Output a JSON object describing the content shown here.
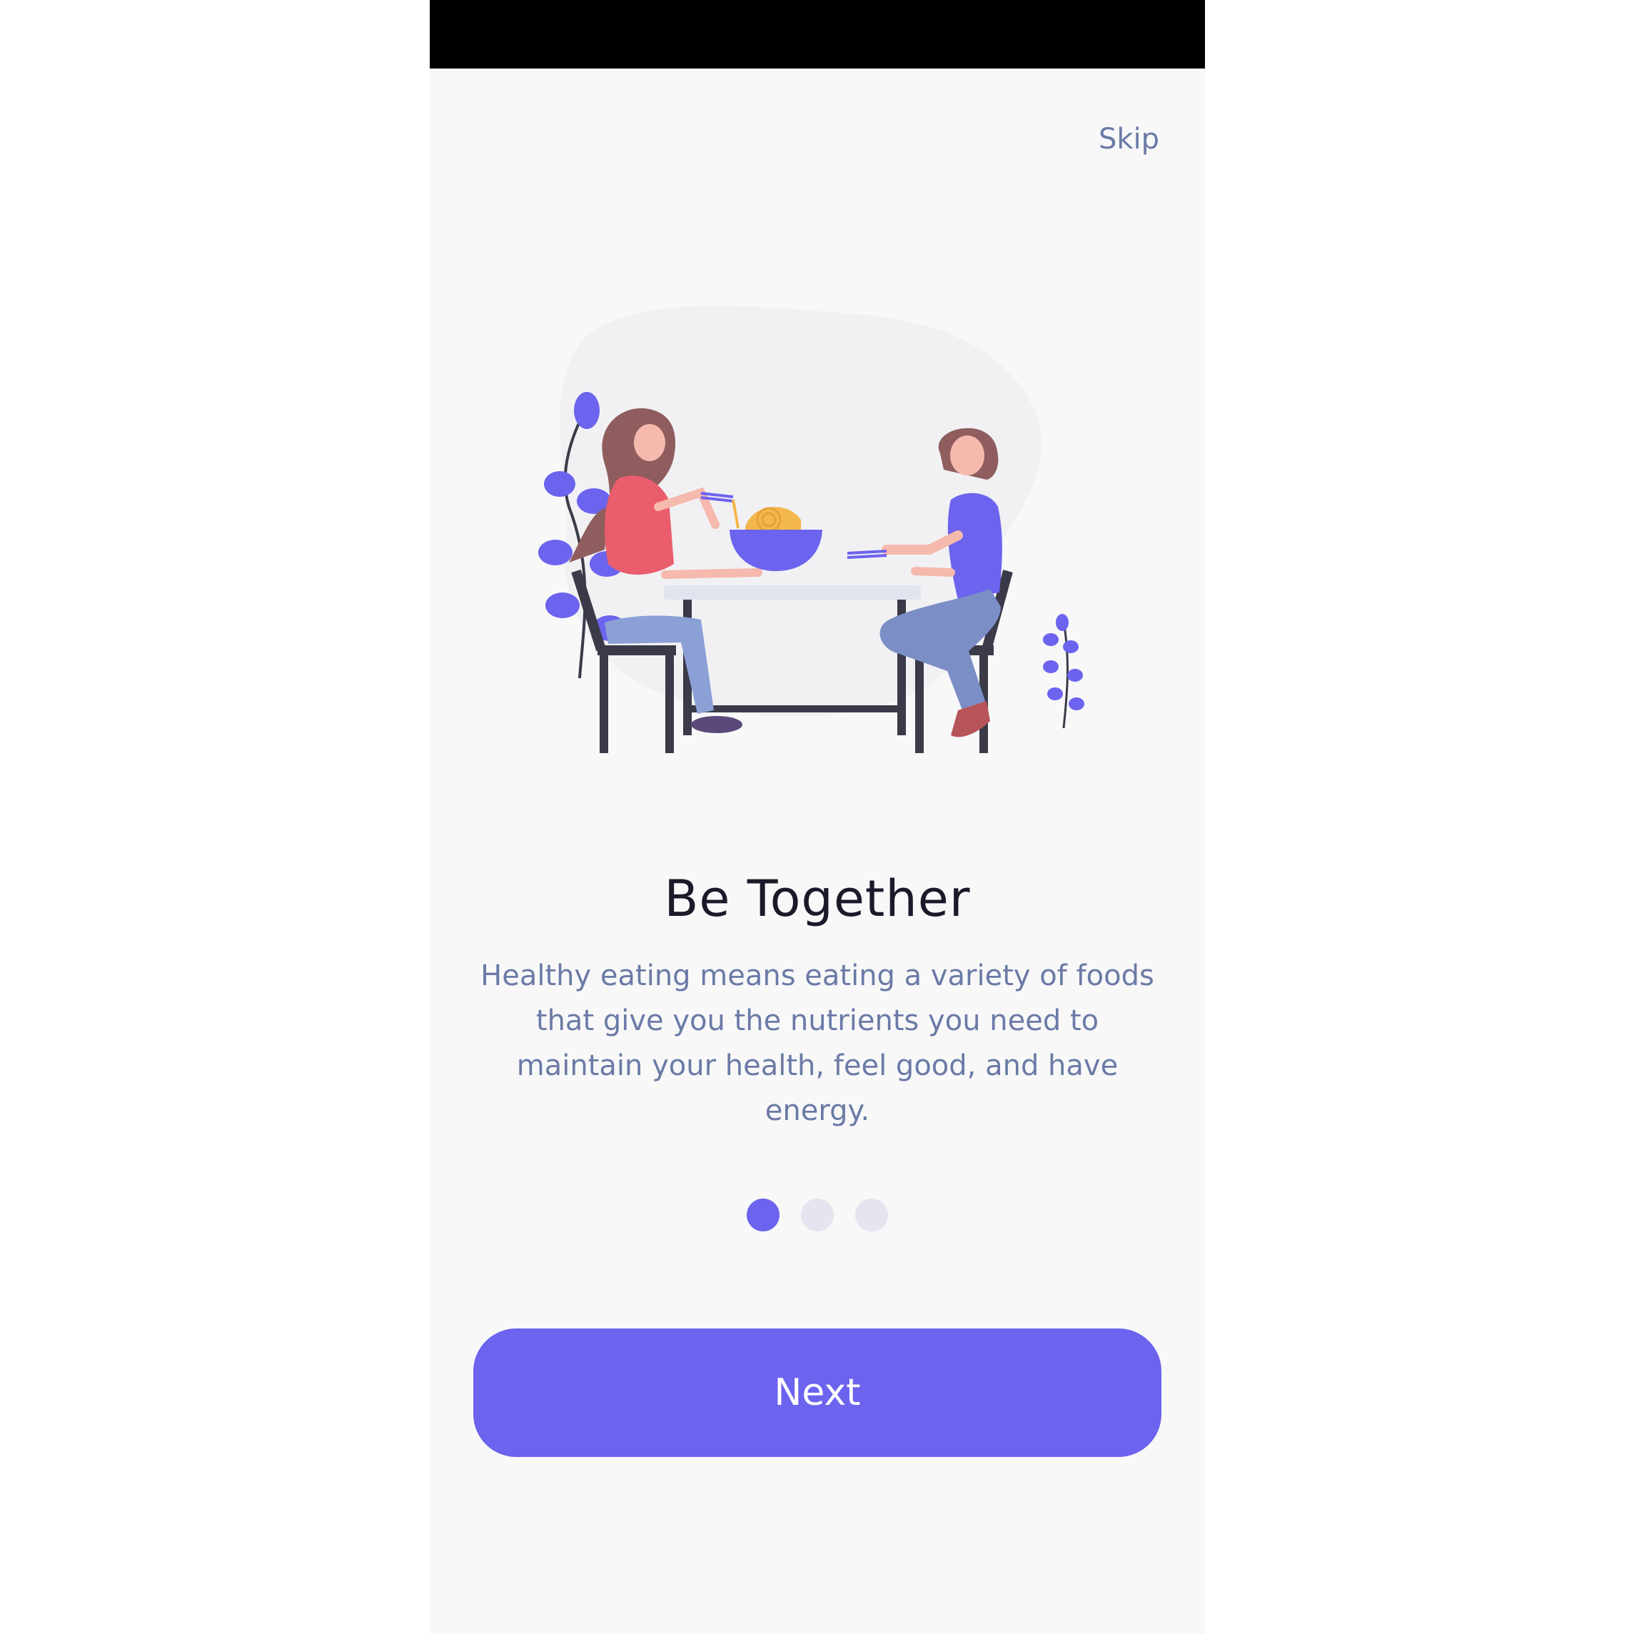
{
  "header": {
    "skip_label": "Skip"
  },
  "onboarding": {
    "title": "Be Together",
    "description": "Healthy eating means eating a variety of foods that give you the nutrients you need to maintain your health, feel good, and have energy.",
    "pagination": {
      "total": 3,
      "active_index": 0
    }
  },
  "actions": {
    "next_label": "Next"
  },
  "colors": {
    "accent": "#6c63ee",
    "title": "#1b1a2a",
    "muted_text": "#6b7aa6",
    "background": "#f8f8f9",
    "inactive_dot": "#e4e5ee"
  }
}
